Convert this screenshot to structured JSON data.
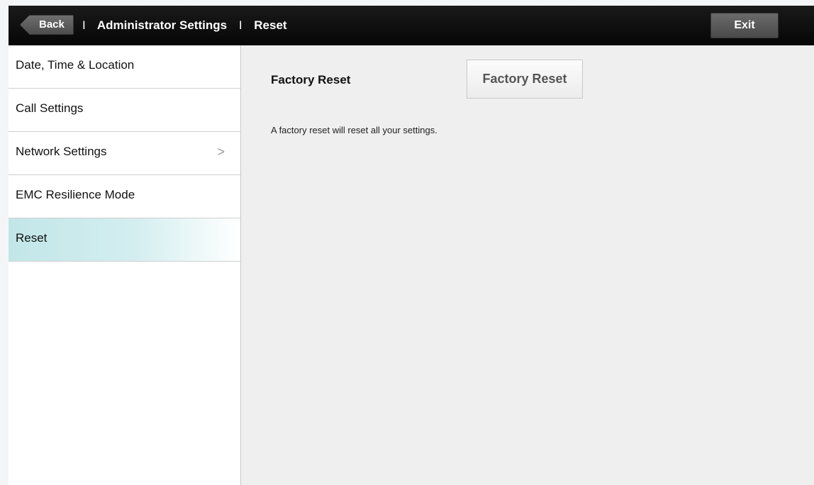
{
  "header": {
    "back_label": "Back",
    "separator": "I",
    "breadcrumb": [
      "Administrator Settings",
      "Reset"
    ],
    "exit_label": "Exit"
  },
  "sidebar": {
    "items": [
      {
        "label": "Date, Time & Location",
        "active": false
      },
      {
        "label": "Call Settings",
        "active": false
      },
      {
        "label": "Network Settings",
        "active": false,
        "chevron": ">"
      },
      {
        "label": "EMC Resilience Mode",
        "active": false
      },
      {
        "label": "Reset",
        "active": true
      }
    ]
  },
  "main": {
    "section_title": "Factory Reset",
    "button_label": "Factory Reset",
    "description": "A factory reset will reset all your settings."
  },
  "colors": {
    "topbar": "#0a0a0a",
    "active_item": "#c2e6e8",
    "content_bg": "#efefef"
  }
}
